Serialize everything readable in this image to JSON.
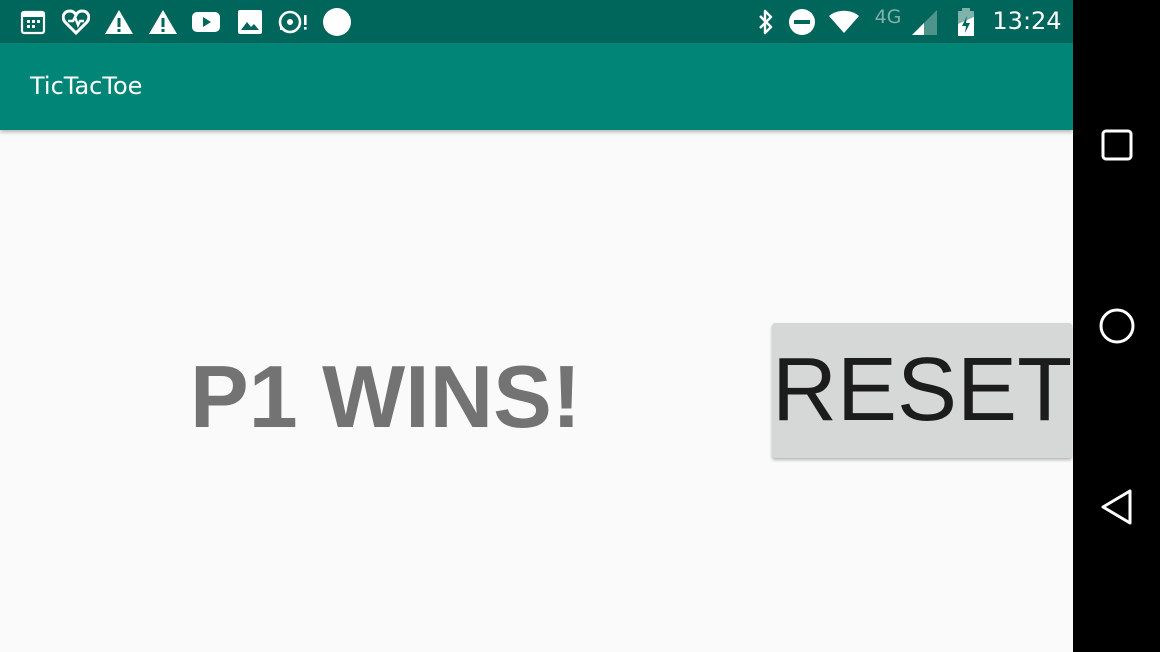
{
  "status_bar": {
    "time": "13:24",
    "network_type": "4G",
    "background_color": "#00665c",
    "left_icons": [
      "calendar-icon",
      "health-icon",
      "warning-icon",
      "warning-icon",
      "youtube-icon",
      "image-icon",
      "sync-icon",
      "circle-icon"
    ],
    "right_icons": [
      "bluetooth-icon",
      "do-not-disturb-icon",
      "wifi-icon",
      "signal-icon",
      "battery-icon"
    ]
  },
  "app_bar": {
    "title": "TicTacToe",
    "background_color": "#008577"
  },
  "game": {
    "result_text": "P1 WINS!",
    "reset_label": "RESET"
  },
  "nav_bar": {
    "buttons": [
      "recents-icon",
      "home-icon",
      "back-icon"
    ]
  }
}
